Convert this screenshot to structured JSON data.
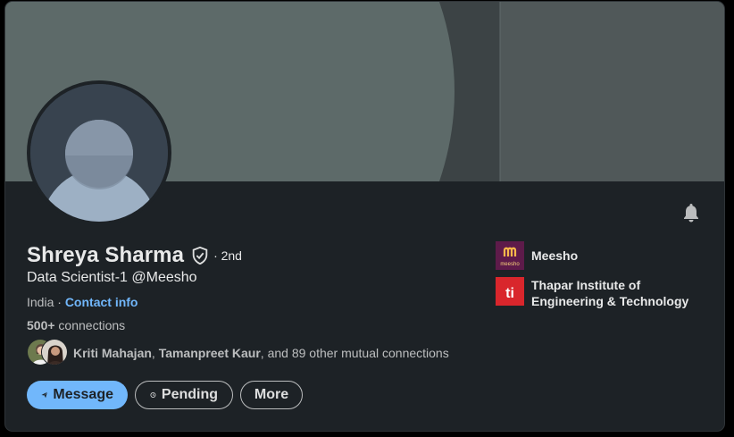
{
  "profile": {
    "name": "Shreya Sharma",
    "degree": "· 2nd",
    "headline": "Data Scientist-1 @Meesho",
    "location": "India",
    "location_separator": " · ",
    "contact_info": "Contact info",
    "connections_count": "500+",
    "connections_label": " connections"
  },
  "mutual": {
    "name1": "Kriti Mahajan",
    "separator": ", ",
    "name2": "Tamanpreet Kaur",
    "rest": ", and 89 other mutual connections"
  },
  "actions": {
    "message": "Message",
    "pending": "Pending",
    "more": "More"
  },
  "experience": [
    {
      "name": "Meesho",
      "logo_text": "meesho",
      "logo_color": "#5e1b4a"
    },
    {
      "name": "Thapar Institute of Engineering & Technology",
      "logo_text": "ti",
      "logo_color": "#d9262c"
    }
  ],
  "colors": {
    "card_bg": "#1d2226",
    "accent": "#71b7fb",
    "banner_light": "#5d6a69",
    "banner_dark": "#3f4647"
  },
  "icons": {
    "bell": "bell-icon",
    "verified": "shield-check-icon",
    "send": "paper-plane-icon",
    "clock": "clock-icon"
  }
}
